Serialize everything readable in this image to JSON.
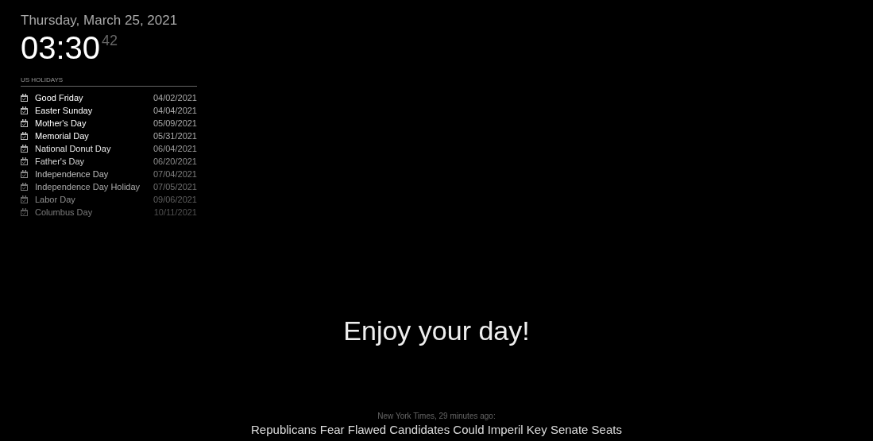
{
  "clock": {
    "date": "Thursday, March 25, 2021",
    "time": "03:30",
    "seconds": "42"
  },
  "calendar": {
    "header": "US HOLIDAYS",
    "events": [
      {
        "title": "Good Friday",
        "date": "04/02/2021"
      },
      {
        "title": "Easter Sunday",
        "date": "04/04/2021"
      },
      {
        "title": "Mother's Day",
        "date": "05/09/2021"
      },
      {
        "title": "Memorial Day",
        "date": "05/31/2021"
      },
      {
        "title": "National Donut Day",
        "date": "06/04/2021"
      },
      {
        "title": "Father's Day",
        "date": "06/20/2021"
      },
      {
        "title": "Independence Day",
        "date": "07/04/2021"
      },
      {
        "title": "Independence Day Holiday",
        "date": "07/05/2021"
      },
      {
        "title": "Labor Day",
        "date": "09/06/2021"
      },
      {
        "title": "Columbus Day",
        "date": "10/11/2021"
      }
    ]
  },
  "compliment": "Enjoy your day!",
  "news": {
    "source": "New York Times, 29 minutes ago:",
    "headline": "Republicans Fear Flawed Candidates Could Imperil Key Senate Seats"
  }
}
